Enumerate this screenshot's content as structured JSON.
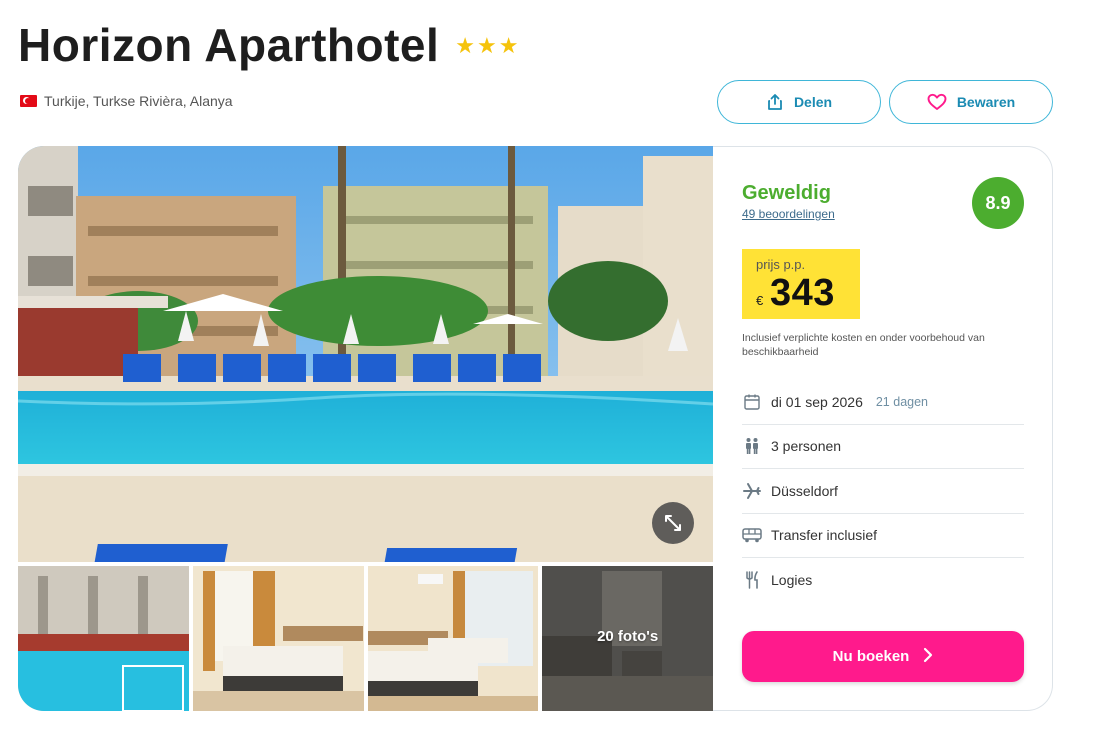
{
  "hotel": {
    "name": "Horizon Aparthotel",
    "stars": [
      "★",
      "★",
      "★"
    ],
    "location": "Turkije, Turkse Rivièra, Alanya"
  },
  "actions": {
    "share_label": "Delen",
    "save_label": "Bewaren"
  },
  "gallery": {
    "more_photos_label": "20 foto's",
    "expand_icon": "expand-arrows-icon"
  },
  "rating": {
    "word": "Geweldig",
    "reviews": "49 beoordelingen",
    "score": "8.9"
  },
  "price": {
    "label": "prijs p.p.",
    "currency": "€",
    "amount": "343",
    "note": "Inclusief verplichte kosten en onder voorbehoud van beschikbaarheid"
  },
  "details": {
    "date": "di 01 sep 2026",
    "duration": "21 dagen",
    "persons": "3 personen",
    "departure": "Düsseldorf",
    "transfer": "Transfer inclusief",
    "board": "Logies"
  },
  "book": {
    "label": "Nu boeken"
  },
  "colors": {
    "accent_pink": "#ff1a8c",
    "rating_green": "#4cad2f",
    "price_yellow": "#ffe236",
    "outline_blue": "#3fb6d8"
  }
}
